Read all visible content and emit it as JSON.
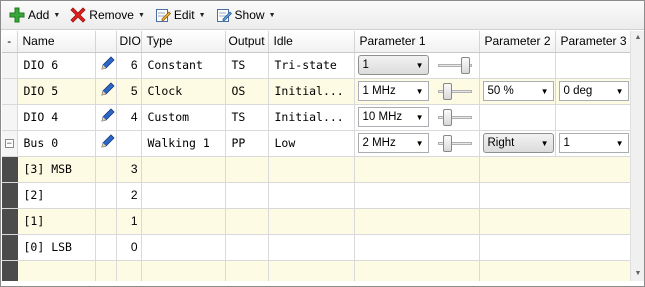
{
  "toolbar": {
    "add_label": "Add",
    "remove_label": "Remove",
    "edit_label": "Edit",
    "show_label": "Show"
  },
  "columns": [
    "-",
    "Name",
    "",
    "DIO",
    "Type",
    "Output",
    "Idle",
    "Parameter 1",
    "Parameter 2",
    "Parameter 3"
  ],
  "rows": [
    {
      "name": "DIO 6",
      "dio": "6",
      "type": "Constant",
      "output": "TS",
      "idle": "Tri-state",
      "p1": "1",
      "p1_slider": 0.9,
      "p2": "",
      "p3": ""
    },
    {
      "name": "DIO 5",
      "dio": "5",
      "type": "Clock",
      "output": "OS",
      "idle": "Initial...",
      "p1": "1 MHz",
      "p1_slider": 0.2,
      "p2": "50 %",
      "p3": "0 deg"
    },
    {
      "name": "DIO 4",
      "dio": "4",
      "type": "Custom",
      "output": "TS",
      "idle": "Initial...",
      "p1": "10 MHz",
      "p1_slider": 0.2,
      "p2": "",
      "p3": ""
    },
    {
      "name": "Bus 0",
      "dio": "",
      "type": "Walking 1",
      "output": "PP",
      "idle": "Low",
      "p1": "2 MHz",
      "p1_slider": 0.2,
      "p2": "Right",
      "p3": "1"
    },
    {
      "name": "[3] MSB",
      "dio": "3"
    },
    {
      "name": "[2]",
      "dio": "2"
    },
    {
      "name": "[1]",
      "dio": "1"
    },
    {
      "name": "[0] LSB",
      "dio": "0"
    }
  ],
  "expander_symbol": "−",
  "colors": {
    "row_alt": "#fdfbe3",
    "bus_bar": "#4b4b4b"
  }
}
